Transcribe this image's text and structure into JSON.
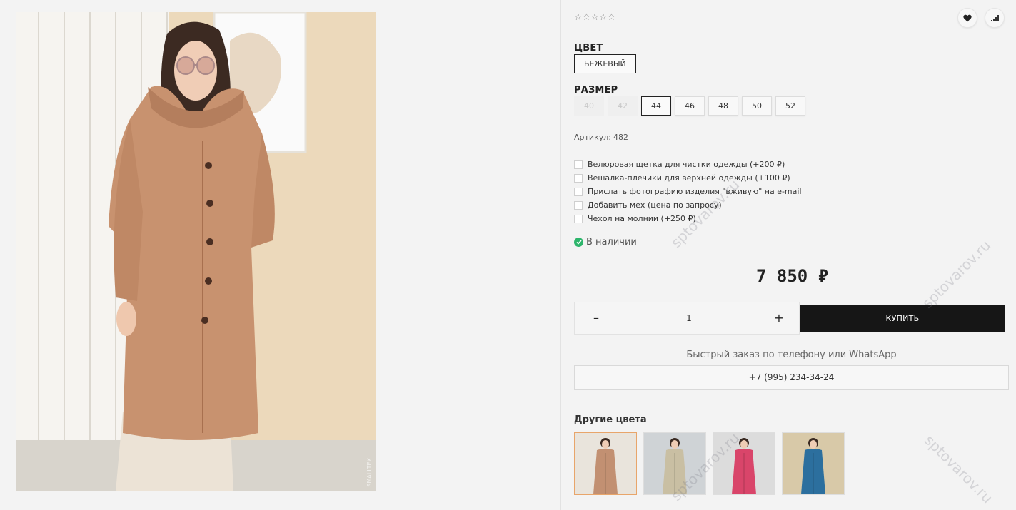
{
  "product": {
    "rating_stars": "☆☆☆☆☆",
    "color_label": "ЦВЕТ",
    "color_value": "БЕЖЕВЫЙ",
    "size_label": "РАЗМЕР",
    "sizes": [
      {
        "label": "40",
        "state": "disabled"
      },
      {
        "label": "42",
        "state": "disabled"
      },
      {
        "label": "44",
        "state": "selected"
      },
      {
        "label": "46",
        "state": "available"
      },
      {
        "label": "48",
        "state": "available"
      },
      {
        "label": "50",
        "state": "available"
      },
      {
        "label": "52",
        "state": "available"
      }
    ],
    "sku_label": "Артикул:",
    "sku_value": "482",
    "options": [
      "Велюровая щетка для чистки одежды (+200 ₽)",
      "Вешалка-плечики для верхней одежды (+100 ₽)",
      "Прислать фотографию изделия \"вживую\" на e-mail",
      "Добавить мех (цена по запросу)",
      "Чехол на молнии (+250 ₽)"
    ],
    "stock_status": "В наличии",
    "price": "7 850 ₽",
    "quantity": "1",
    "qty_minus": "–",
    "qty_plus": "+",
    "buy_label": "КУПИТЬ",
    "quick_order_text": "Быстрый заказ по телефону или WhatsApp",
    "phone": "+7 (995) 234-34-24",
    "other_colors_label": "Другие цвета",
    "other_colors": [
      {
        "color_name": "beige",
        "coat_color": "#c29072",
        "active": true
      },
      {
        "color_name": "light-beige",
        "coat_color": "#c9bfa3",
        "active": false
      },
      {
        "color_name": "pink",
        "coat_color": "#d9456a",
        "active": false
      },
      {
        "color_name": "blue",
        "coat_color": "#2c6f9e",
        "active": false
      }
    ]
  },
  "icons": {
    "wishlist": "heart-icon",
    "compare": "bars-icon",
    "stock": "check-circle-icon"
  },
  "photo": {
    "corner_mark": "SMALLTEX",
    "coat_color": "#c8926f"
  },
  "watermark_text": "sptovarov.ru",
  "colors": {
    "buy_button_bg": "#161616",
    "stock_green": "#2db56b",
    "active_thumb_border": "#e8a56a"
  }
}
